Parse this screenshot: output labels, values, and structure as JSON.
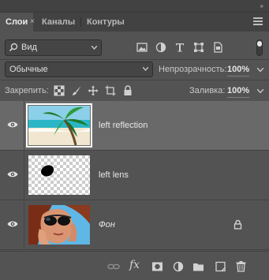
{
  "tabs": [
    {
      "label": "Слои",
      "active": true
    },
    {
      "label": "Каналы",
      "active": false
    },
    {
      "label": "Контуры",
      "active": false
    }
  ],
  "close_symbol": "×",
  "collapse_symbol": "»",
  "filter": {
    "kind_label": "Вид",
    "icons": [
      "image-filter-icon",
      "adjustment-filter-icon",
      "type-filter-icon",
      "shape-filter-icon",
      "smart-object-filter-icon"
    ]
  },
  "blend": {
    "mode": "Обычные",
    "opacity_label": "Непрозрачность:",
    "opacity_value": "100%"
  },
  "locks": {
    "label": "Закрепить:",
    "fill_label": "Заливка:",
    "fill_value": "100%"
  },
  "layers": [
    {
      "name": "left reflection",
      "visible": true,
      "selected": true,
      "locked": false
    },
    {
      "name": "left lens",
      "visible": true,
      "selected": false,
      "locked": false
    },
    {
      "name": "Фон",
      "visible": true,
      "selected": false,
      "locked": true
    }
  ],
  "bottom_toolbar": {
    "fx_label": "fx",
    "icons": [
      "link-layers-icon",
      "fx-icon",
      "add-mask-icon",
      "adjustment-layer-icon",
      "new-group-icon",
      "new-layer-icon",
      "delete-layer-icon"
    ]
  },
  "colors": {
    "panel_bg": "#535353",
    "header_bg": "#424242",
    "selected_row": "#696969"
  }
}
